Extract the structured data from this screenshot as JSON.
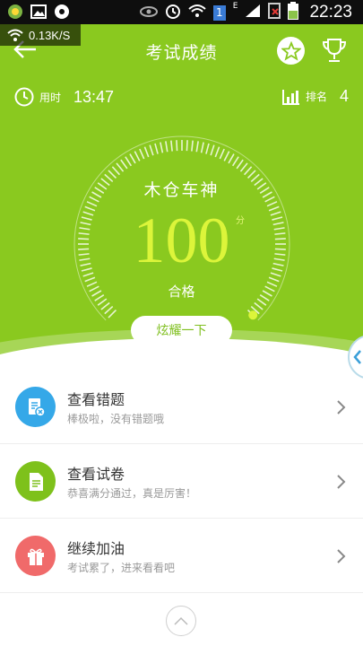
{
  "status_bar": {
    "time": "22:23",
    "sim_label": "1",
    "net_label": "E",
    "icons": [
      "app-icon",
      "image-icon",
      "message-icon",
      "eye-icon",
      "alarm-icon",
      "wifi-icon",
      "sim-icon",
      "signal-icon",
      "no-sim-icon",
      "battery-icon"
    ]
  },
  "speed_overlay": {
    "text": "0.13K/S"
  },
  "header": {
    "title": "考试成绩",
    "back_icon": "arrow-left-icon",
    "star_icon": "star-icon",
    "trophy_icon": "trophy-icon"
  },
  "stats": {
    "time_label": "用时",
    "time_value": "13:47",
    "rank_label": "排名",
    "rank_value": "4"
  },
  "result": {
    "rank_title": "木仓车神",
    "score": "100",
    "score_unit": "分",
    "score_fraction": 1.0,
    "pass_text": "合格",
    "show_off_button": "炫耀一下"
  },
  "list": [
    {
      "title": "查看错题",
      "subtitle": "棒极啦，没有错题哦",
      "icon": "wrong-questions-icon",
      "color": "#35a8e8"
    },
    {
      "title": "查看试卷",
      "subtitle": "恭喜满分通过，真是厉害！",
      "icon": "document-icon",
      "color": "#7ec11b"
    },
    {
      "title": "继续加油",
      "subtitle": "考试累了，进来看看吧",
      "icon": "gift-icon",
      "color": "#f06a6a"
    }
  ],
  "colors": {
    "hero_green": "#8ac91f",
    "score_yellow": "#dcf53a"
  }
}
